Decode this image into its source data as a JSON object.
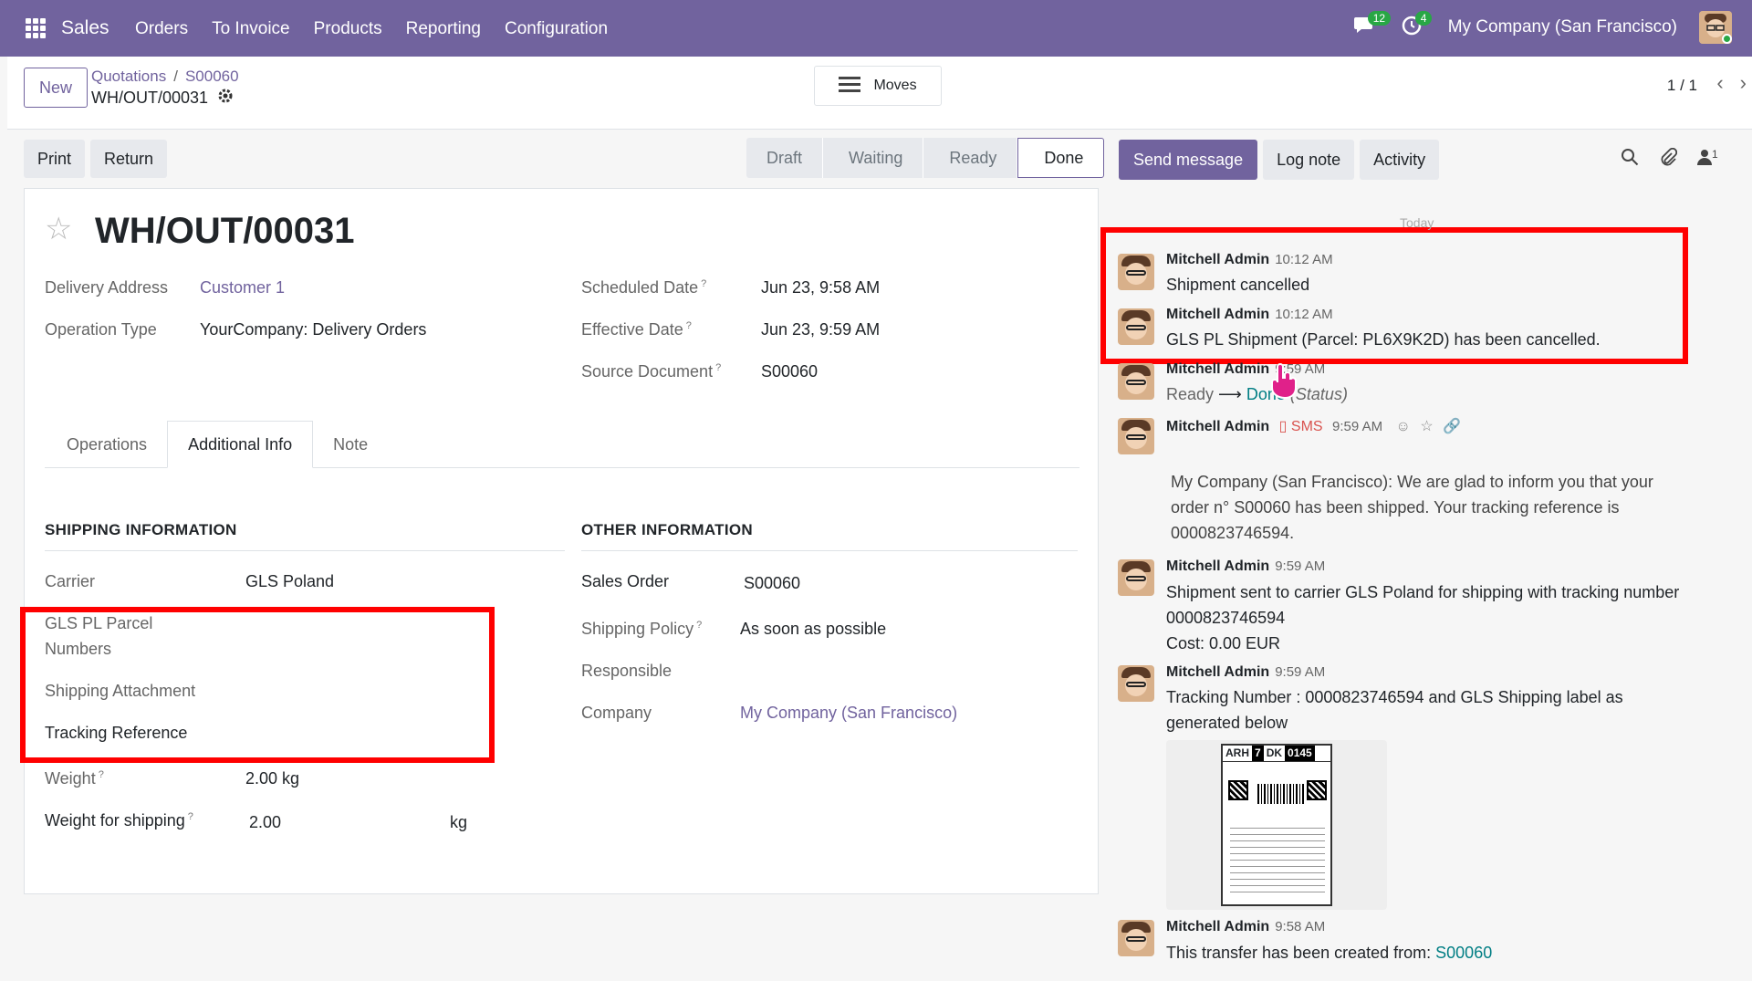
{
  "topbar": {
    "app_name": "Sales",
    "menu": [
      "Orders",
      "To Invoice",
      "Products",
      "Reporting",
      "Configuration"
    ],
    "messages_count": "12",
    "activities_count": "4",
    "company": "My Company (San Francisco)"
  },
  "control": {
    "new_label": "New",
    "breadcrumb_1": "Quotations",
    "breadcrumb_2": "S00060",
    "current_record": "WH/OUT/00031",
    "moves_label": "Moves",
    "pager": "1 / 1"
  },
  "actions": {
    "print": "Print",
    "return": "Return"
  },
  "stages": [
    "Draft",
    "Waiting",
    "Ready",
    "Done"
  ],
  "form": {
    "title": "WH/OUT/00031",
    "delivery_address_label": "Delivery Address",
    "delivery_address": "Customer 1",
    "operation_type_label": "Operation Type",
    "operation_type": "YourCompany: Delivery Orders",
    "scheduled_date_label": "Scheduled Date",
    "scheduled_date": "Jun 23, 9:58 AM",
    "effective_date_label": "Effective Date",
    "effective_date": "Jun 23, 9:59 AM",
    "source_document_label": "Source Document",
    "source_document": "S00060",
    "tabs": [
      "Operations",
      "Additional Info",
      "Note"
    ],
    "shipping_header": "SHIPPING INFORMATION",
    "carrier_label": "Carrier",
    "carrier": "GLS Poland",
    "parcel_numbers_label_1": "GLS PL Parcel",
    "parcel_numbers_label_2": "Numbers",
    "shipping_attachment_label": "Shipping Attachment",
    "tracking_reference_label": "Tracking Reference",
    "weight_label": "Weight",
    "weight": "2.00 kg",
    "weight_shipping_label": "Weight for shipping",
    "weight_shipping": "2.00",
    "weight_shipping_unit": "kg",
    "other_header": "OTHER INFORMATION",
    "sales_order_label": "Sales Order",
    "sales_order": "S00060",
    "shipping_policy_label": "Shipping Policy",
    "shipping_policy": "As soon as possible",
    "responsible_label": "Responsible",
    "company_label": "Company",
    "company": "My Company (San Francisco)",
    "help_mark": "?"
  },
  "chatter": {
    "send_message": "Send message",
    "log_note": "Log note",
    "activity": "Activity",
    "followers_count": "1",
    "today": "Today",
    "messages": [
      {
        "author": "Mitchell Admin",
        "time": "10:12 AM",
        "body": "Shipment cancelled"
      },
      {
        "author": "Mitchell Admin",
        "time": "10:12 AM",
        "body": "GLS PL Shipment (Parcel: PL6X9K2D) has been cancelled."
      },
      {
        "author": "Mitchell Admin",
        "time": "9:59 AM",
        "from": "Ready",
        "to": "Done",
        "field": "(Status)"
      },
      {
        "author": "Mitchell Admin",
        "channel": "SMS",
        "time": "9:59 AM",
        "line1": "My Company (San Francisco): We are glad to inform you that your",
        "line2": "order n° S00060 has been shipped. Your tracking reference is",
        "line3": "0000823746594."
      },
      {
        "author": "Mitchell Admin",
        "time": "9:59 AM",
        "line1": "Shipment sent to carrier GLS Poland for shipping with tracking number",
        "line2": "0000823746594",
        "line3": "Cost: 0.00 EUR"
      },
      {
        "author": "Mitchell Admin",
        "time": "9:59 AM",
        "line1": "Tracking Number : 0000823746594 and GLS Shipping label as",
        "line2": "generated below"
      },
      {
        "author": "Mitchell Admin",
        "time": "9:58 AM",
        "body": "This transfer has been created from:",
        "link": "S00060"
      }
    ],
    "label_image": {
      "a": "ARH",
      "b": "7",
      "c": "DK",
      "d": "0145"
    }
  },
  "colors": {
    "brand": "#71639e",
    "link": "#017e84",
    "highlight": "#ff0000",
    "sms": "#d9534f"
  }
}
